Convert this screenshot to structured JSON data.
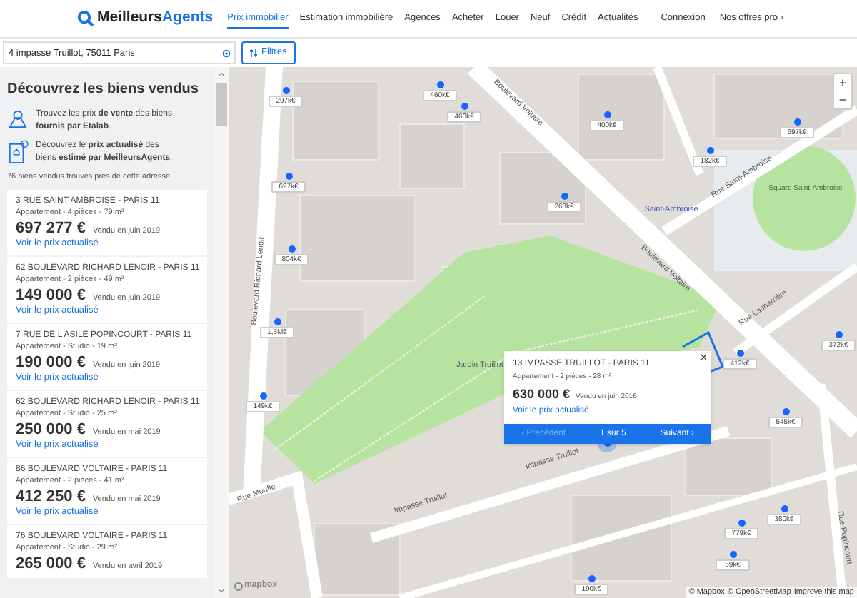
{
  "header": {
    "logo": {
      "first": "Meilleurs",
      "second": "Agents"
    },
    "nav": [
      {
        "label": "Prix immobilier",
        "selected": true
      },
      {
        "label": "Estimation immobilière",
        "selected": false
      },
      {
        "label": "Agences",
        "selected": false
      },
      {
        "label": "Acheter",
        "selected": false
      },
      {
        "label": "Louer",
        "selected": false
      },
      {
        "label": "Neuf",
        "selected": false
      },
      {
        "label": "Crédit",
        "selected": false
      },
      {
        "label": "Actualités",
        "selected": false
      }
    ],
    "links": [
      "Connexion",
      "Nos offres pro ›"
    ]
  },
  "search": {
    "value": "4 impasse Truillot, 75011 Paris",
    "filters": "Filtres"
  },
  "sidebar": {
    "title": "Découvrez les biens vendus",
    "intro": [
      "Trouvez les prix **de vente** des biens **fournis par Etalab**.",
      "Découvrez le **prix actualisé** des biens **estimé par MeilleursAgents**."
    ],
    "count": "76 biens vendus trouvés près de cette adresse",
    "listings": [
      {
        "address": "3 RUE SAINT AMBROISE - PARIS 11",
        "details": "Appartement - 4 pièces - 79 m²",
        "price": "697 277 €",
        "date": "Vendu en juin 2019",
        "link": "Voir le prix actualisé"
      },
      {
        "address": "62 BOULEVARD RICHARD LENOIR - PARIS 11",
        "details": "Appartement - 2 pièces - 49 m²",
        "price": "149 000 €",
        "date": "Vendu en juin 2019",
        "link": "Voir le prix actualisé"
      },
      {
        "address": "7 RUE DE L ASILE POPINCOURT - PARIS 11",
        "details": "Appartement - Studio - 19 m²",
        "price": "190 000 €",
        "date": "Vendu en juin 2019",
        "link": "Voir le prix actualisé"
      },
      {
        "address": "62 BOULEVARD RICHARD LENOIR - PARIS 11",
        "details": "Appartement - Studio - 25 m²",
        "price": "250 000 €",
        "date": "Vendu en mai 2019",
        "link": "Voir le prix actualisé"
      },
      {
        "address": "86 BOULEVARD VOLTAIRE - PARIS 11",
        "details": "Appartement - 2 pièces - 41 m²",
        "price": "412 250 €",
        "date": "Vendu en mai 2019",
        "link": "Voir le prix actualisé"
      },
      {
        "address": "76 BOULEVARD VOLTAIRE - PARIS 11",
        "details": "Appartement - Studio - 29 m²",
        "price": "265 000 €",
        "date": "Vendu en avril 2019"
      }
    ]
  },
  "map": {
    "streets": [
      "Boulevard Richard Lenoir",
      "Boulevard Voltaire",
      "Boulevard Voltaire",
      "Rue Saint-Ambroise",
      "Saint-Ambroise",
      "Square Saint-Ambroise",
      "Rue Lacharrière",
      "Jardin Truillot",
      "Impasse Truillot",
      "Impasse Truillot",
      "Rue Moufle",
      "Rue Popincourt"
    ],
    "markers": [
      "297k€",
      "460k€",
      "460k€",
      "400k€",
      "182k€",
      "697k€",
      "697k€",
      "268k€",
      "804k€",
      "1,3M€",
      "149k€",
      "412k€",
      "372k€",
      "545k€",
      "380k€",
      "779k€",
      "69k€",
      "190k€"
    ],
    "popup": {
      "address": "13 IMPASSE TRUILLOT - PARIS 11",
      "details": "Appartement - 2 pièces - 28 m²",
      "price": "630 000 €",
      "date": "Vendu en juin 2016",
      "link": "Voir le prix actualisé",
      "close": "×",
      "prev": {
        "label": "‹ Précédent",
        "disabled": true
      },
      "page": "1 sur 5",
      "next": {
        "label": "Suivant ›",
        "disabled": false
      }
    },
    "zoom": [
      "+",
      "−"
    ],
    "logo": "mapbox",
    "attribution": [
      "© Mapbox",
      "© OpenStreetMap",
      "Improve this map"
    ]
  }
}
